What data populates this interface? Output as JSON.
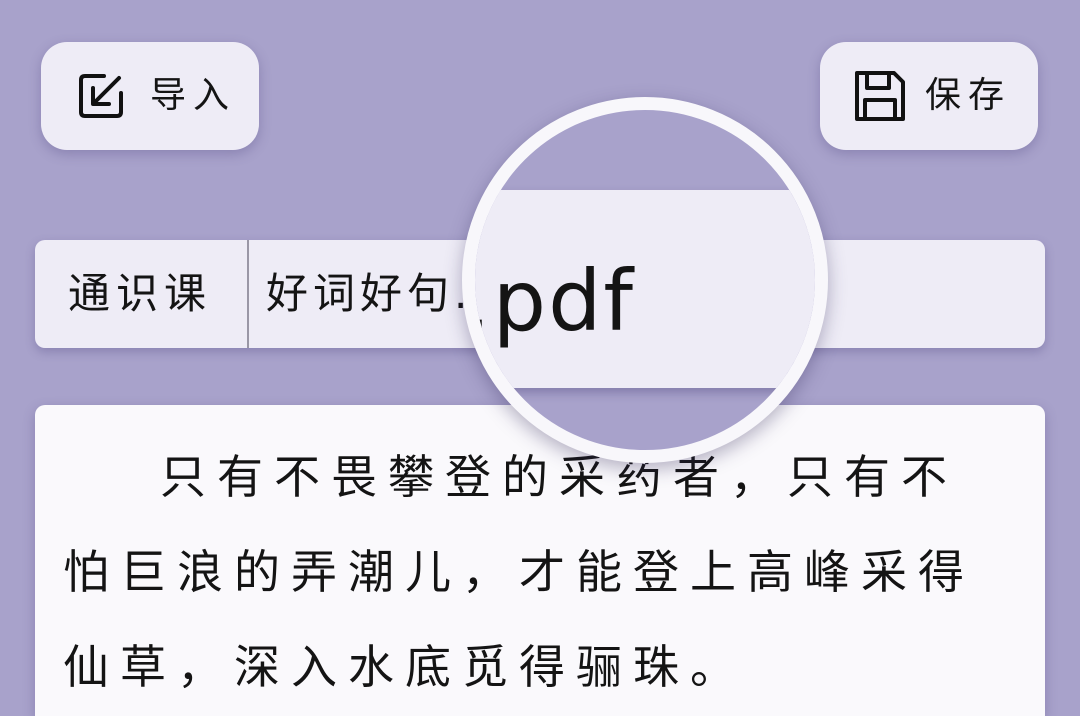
{
  "toolbar": {
    "import": {
      "label": "导入",
      "icon": "import-icon"
    },
    "save": {
      "label": "保存",
      "icon": "save-icon"
    }
  },
  "file_bar": {
    "category": "通识课",
    "filename": "好词好句.pdf"
  },
  "editor": {
    "lines": [
      "只有不畏攀登的采药者，只有不",
      "怕巨浪的弄潮儿，才能登上高峰采得",
      "仙草，深入水底觅得骊珠。"
    ]
  },
  "colors": {
    "background": "#a8a2cb",
    "panel": "#eeecf6",
    "editor": "#faf9fc",
    "text": "#141414",
    "lens_ring": "#f8f7fb"
  }
}
